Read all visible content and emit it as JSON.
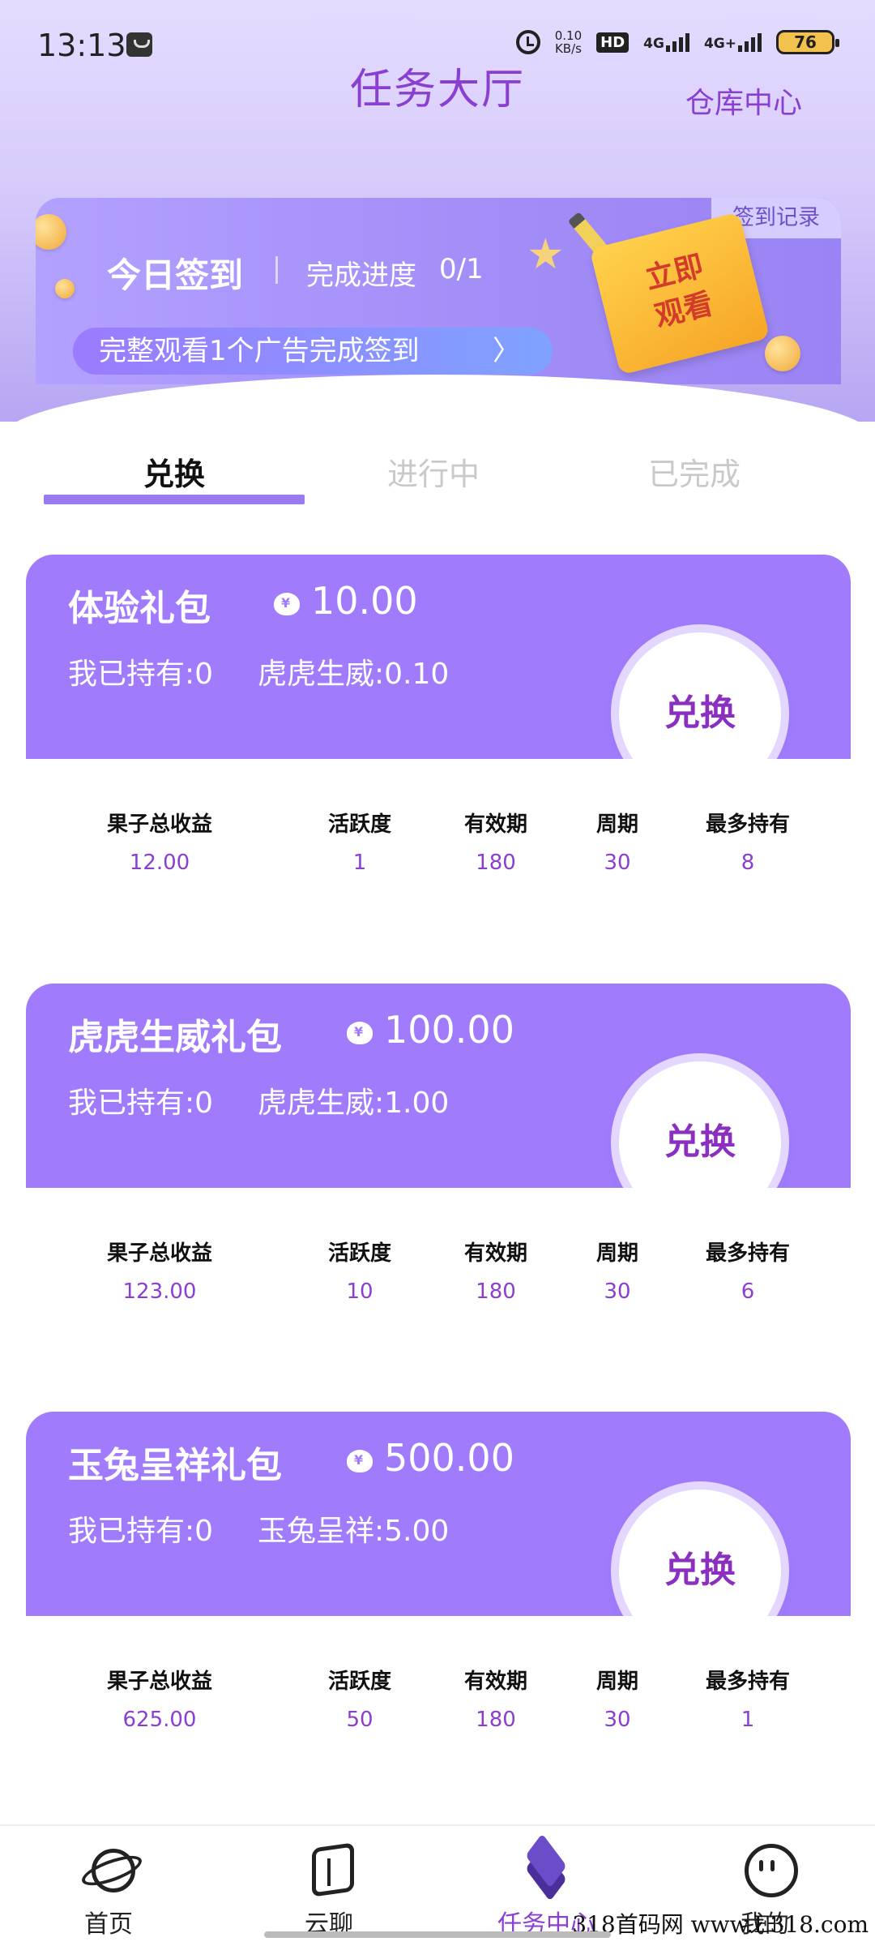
{
  "status_bar": {
    "time": "13:13",
    "netspeed_value": "0.10",
    "netspeed_unit": "KB/s",
    "hd_label": "HD",
    "signal1_label": "4G",
    "signal2_label": "4G+",
    "battery": "76"
  },
  "header": {
    "title": "任务大厅",
    "warehouse_link": "仓库中心"
  },
  "signin": {
    "record_label": "签到记录",
    "title": "今日签到",
    "progress_label": "完成进度",
    "progress_value": "0/1",
    "action_text": "完整观看1个广告完成签到",
    "action_chevron": "〉",
    "note_line1": "立即",
    "note_line2": "观看"
  },
  "tabs": [
    {
      "label": "兑换",
      "active": true
    },
    {
      "label": "进行中",
      "active": false
    },
    {
      "label": "已完成",
      "active": false
    }
  ],
  "stat_labels": {
    "total_income": "果子总收益",
    "activity": "活跃度",
    "validity": "有效期",
    "cycle": "周期",
    "max_hold": "最多持有"
  },
  "packs": [
    {
      "name": "体验礼包",
      "price": "10.00",
      "held": "我已持有:0",
      "reward": "虎虎生威:0.10",
      "button": "兑换",
      "stats": {
        "total_income": "12.00",
        "activity": "1",
        "validity": "180",
        "cycle": "30",
        "max_hold": "8"
      }
    },
    {
      "name": "虎虎生威礼包",
      "price": "100.00",
      "held": "我已持有:0",
      "reward": "虎虎生威:1.00",
      "button": "兑换",
      "stats": {
        "total_income": "123.00",
        "activity": "10",
        "validity": "180",
        "cycle": "30",
        "max_hold": "6"
      }
    },
    {
      "name": "玉兔呈祥礼包",
      "price": "500.00",
      "held": "我已持有:0",
      "reward": "玉兔呈祥:5.00",
      "button": "兑换",
      "stats": {
        "total_income": "625.00",
        "activity": "50",
        "validity": "180",
        "cycle": "30",
        "max_hold": "1"
      }
    }
  ],
  "bottom_nav": [
    {
      "label": "首页",
      "icon": "planet-icon",
      "active": false
    },
    {
      "label": "云聊",
      "icon": "cube-icon",
      "active": false
    },
    {
      "label": "任务中心",
      "icon": "layers-icon",
      "active": true
    },
    {
      "label": "我的",
      "icon": "face-icon",
      "active": false
    }
  ],
  "watermark": "318首码网 www.E318.com",
  "colors": {
    "accent": "#8a3fd1",
    "card_purple": "#a07bfb",
    "tab_underline": "#9a7bf1"
  }
}
